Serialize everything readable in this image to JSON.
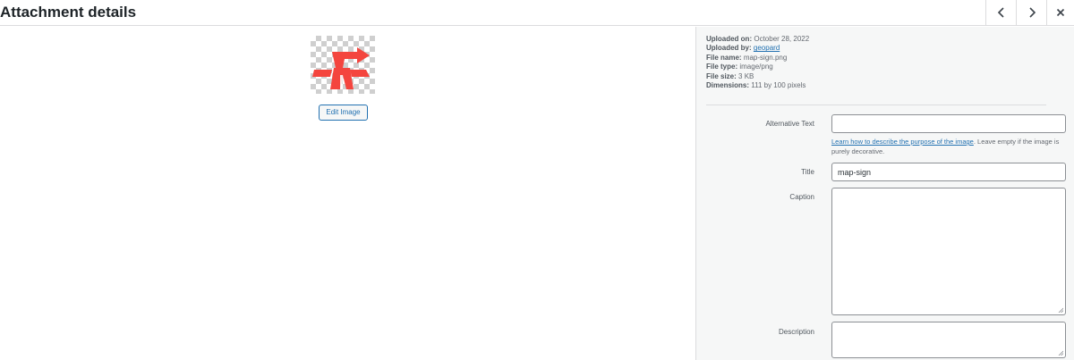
{
  "header": {
    "title": "Attachment details",
    "prev_icon": "chevron-left-icon",
    "next_icon": "chevron-right-icon",
    "close_icon": "close-icon"
  },
  "preview": {
    "edit_button_label": "Edit Image",
    "image_checker_color": "#cfcfcf",
    "image_sign_color": "#f4453e"
  },
  "meta": {
    "uploaded_on_label": "Uploaded on:",
    "uploaded_on_value": "October 28, 2022",
    "uploaded_by_label": "Uploaded by:",
    "uploaded_by_value": "geopard",
    "file_name_label": "File name:",
    "file_name_value": "map-sign.png",
    "file_type_label": "File type:",
    "file_type_value": "image/png",
    "file_size_label": "File size:",
    "file_size_value": "3 KB",
    "dimensions_label": "Dimensions:",
    "dimensions_value": "111 by 100 pixels"
  },
  "fields": {
    "alt_text_label": "Alternative Text",
    "alt_text_value": "",
    "alt_help_link": "Learn how to describe the purpose of the image",
    "alt_help_text": ". Leave empty if the image is purely decorative.",
    "title_label": "Title",
    "title_value": "map-sign",
    "caption_label": "Caption",
    "caption_value": "",
    "description_label": "Description",
    "description_value": ""
  },
  "colors": {
    "accent": "#2271b1",
    "panel_bg": "#f6f7f7",
    "border": "#dcdcde"
  }
}
